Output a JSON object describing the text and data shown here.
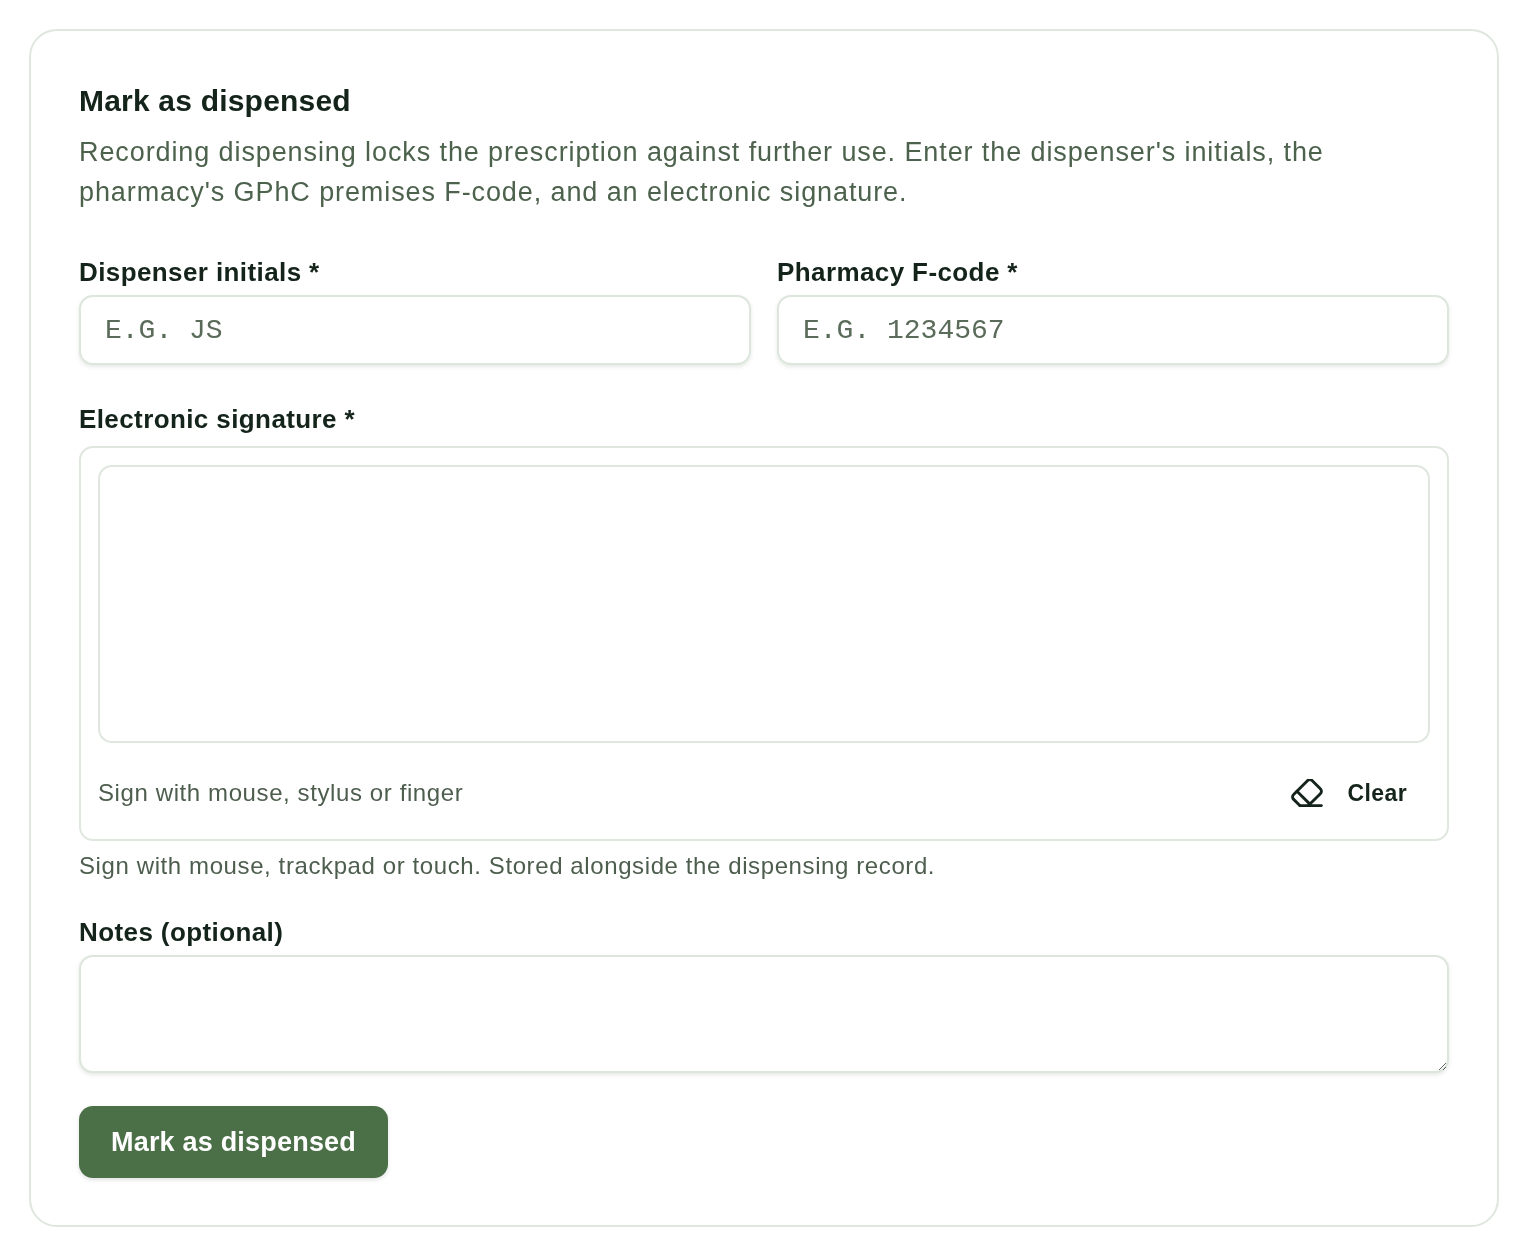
{
  "form": {
    "title": "Mark as dispensed",
    "description": "Recording dispensing locks the prescription against further use. Enter the dispenser's initials, the pharmacy's GPhC premises F-code, and an electronic signature.",
    "fields": [
      {
        "label": "Dispenser initials *",
        "placeholder": "E.G. JS"
      },
      {
        "label": "Pharmacy F-code *",
        "placeholder": "E.G. 1234567"
      }
    ],
    "signature": {
      "label": "Electronic signature *",
      "pad_hint": "Sign with mouse, stylus or finger",
      "clear_button": "Clear",
      "help": "Sign with mouse, trackpad or touch. Stored alongside the dispensing record."
    },
    "notes": {
      "label": "Notes (optional)"
    },
    "submit_button": "Mark as dispensed"
  }
}
